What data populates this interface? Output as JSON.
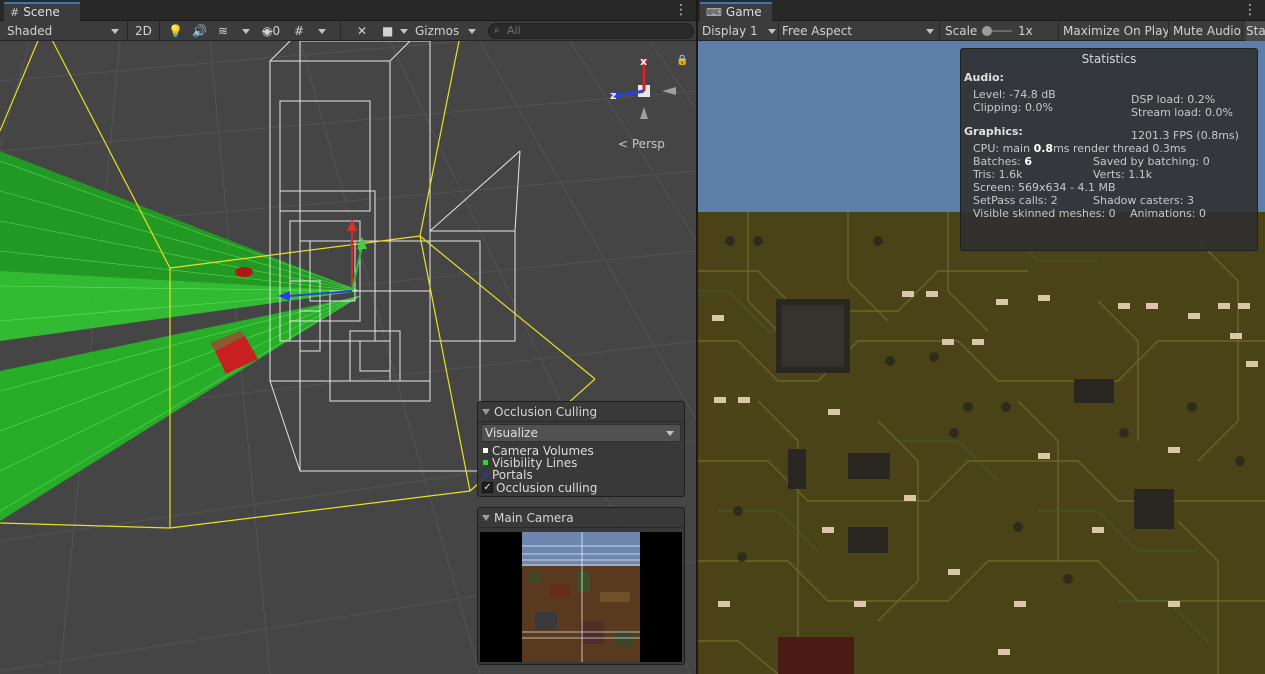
{
  "scene": {
    "tab_label": "Scene",
    "toolbar": {
      "shading_mode": "Shaded",
      "mode_2d": "2D",
      "hidden_count": "0",
      "gizmos_label": "Gizmos",
      "search_placeholder": "All"
    },
    "gizmo": {
      "x_label": "x",
      "z_label": "z",
      "persp_label": "Persp"
    },
    "occlusion_panel": {
      "title": "Occlusion Culling",
      "dropdown_value": "Visualize",
      "legend": [
        {
          "label": "Camera Volumes",
          "color": "#ffffff"
        },
        {
          "label": "Visibility Lines",
          "color": "#22dd22"
        },
        {
          "label": "Portals",
          "color": "#2b3a80"
        }
      ],
      "checkbox_label": "Occlusion culling",
      "checkbox_checked": true
    },
    "camera_preview": {
      "title": "Main Camera"
    }
  },
  "game": {
    "tab_label": "Game",
    "toolbar": {
      "display": "Display 1",
      "aspect": "Free Aspect",
      "scale_label": "Scale",
      "scale_value": "1x",
      "maximize_label": "Maximize On Play",
      "mute_label": "Mute Audio",
      "stats_label": "Stats"
    },
    "statistics": {
      "title": "Statistics",
      "audio_header": "Audio:",
      "level": "Level: -74.8 dB",
      "clipping": "Clipping: 0.0%",
      "dsp_load": "DSP load: 0.2%",
      "stream_load": "Stream load: 0.0%",
      "graphics_header": "Graphics:",
      "fps": "1201.3 FPS (0.8ms)",
      "cpu_prefix": "CPU: main ",
      "cpu_main": "0.8",
      "cpu_suffix": "ms  render thread 0.3ms",
      "batches_prefix": "Batches: ",
      "batches_value": "6",
      "saved_batching": "Saved by batching: 0",
      "tris": "Tris: 1.6k",
      "verts": "Verts: 1.1k",
      "screen": "Screen: 569x634 - 4.1 MB",
      "setpass": "SetPass calls: 2",
      "shadow_casters": "Shadow casters: 3",
      "skinned": "Visible skinned meshes: 0",
      "animations": "Animations: 0"
    }
  },
  "colors": {
    "tab_accent": "#3a79bb",
    "visibility_lines": "#22dd22",
    "camera_frustum": "#e8e020",
    "sky": "#5c7fa8",
    "pcb": "#4a4318"
  }
}
